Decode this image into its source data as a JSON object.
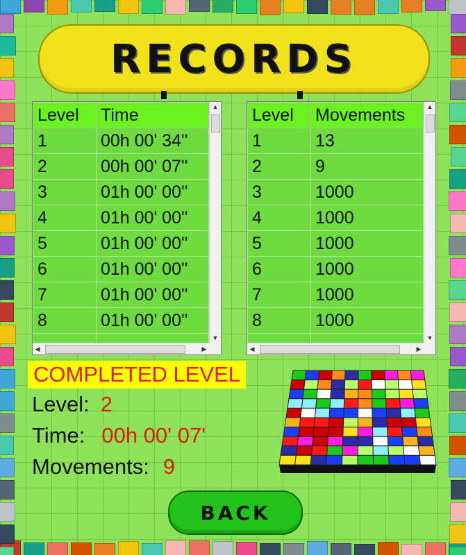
{
  "title": "RECORDS",
  "time_table": {
    "headers": [
      "Level",
      "Time"
    ],
    "rows": [
      [
        "1",
        "00h 00' 34''"
      ],
      [
        "2",
        "00h 00' 07''"
      ],
      [
        "3",
        "01h 00' 00''"
      ],
      [
        "4",
        "01h 00' 00''"
      ],
      [
        "5",
        "01h 00' 00''"
      ],
      [
        "6",
        "01h 00' 00''"
      ],
      [
        "7",
        "01h 00' 00''"
      ],
      [
        "8",
        "01h 00' 00''"
      ]
    ]
  },
  "movements_table": {
    "headers": [
      "Level",
      "Movements"
    ],
    "rows": [
      [
        "1",
        "13"
      ],
      [
        "2",
        "9"
      ],
      [
        "3",
        "1000"
      ],
      [
        "4",
        "1000"
      ],
      [
        "5",
        "1000"
      ],
      [
        "6",
        "1000"
      ],
      [
        "7",
        "1000"
      ],
      [
        "8",
        "1000"
      ]
    ]
  },
  "completed": {
    "heading": "COMPLETED LEVEL",
    "level_label": "Level:",
    "level_value": "2",
    "time_label": "Time:",
    "time_value": "00h 00' 07'",
    "movements_label": "Movements:",
    "movements_value": "9"
  },
  "back_label": "BACK",
  "colors": {
    "background": "#8ee25a",
    "banner": "#f2e21b",
    "header_row": "#69f21f",
    "cell": "#6edc3f",
    "highlight_text": "#e21a0b",
    "button": "#22c41c"
  }
}
